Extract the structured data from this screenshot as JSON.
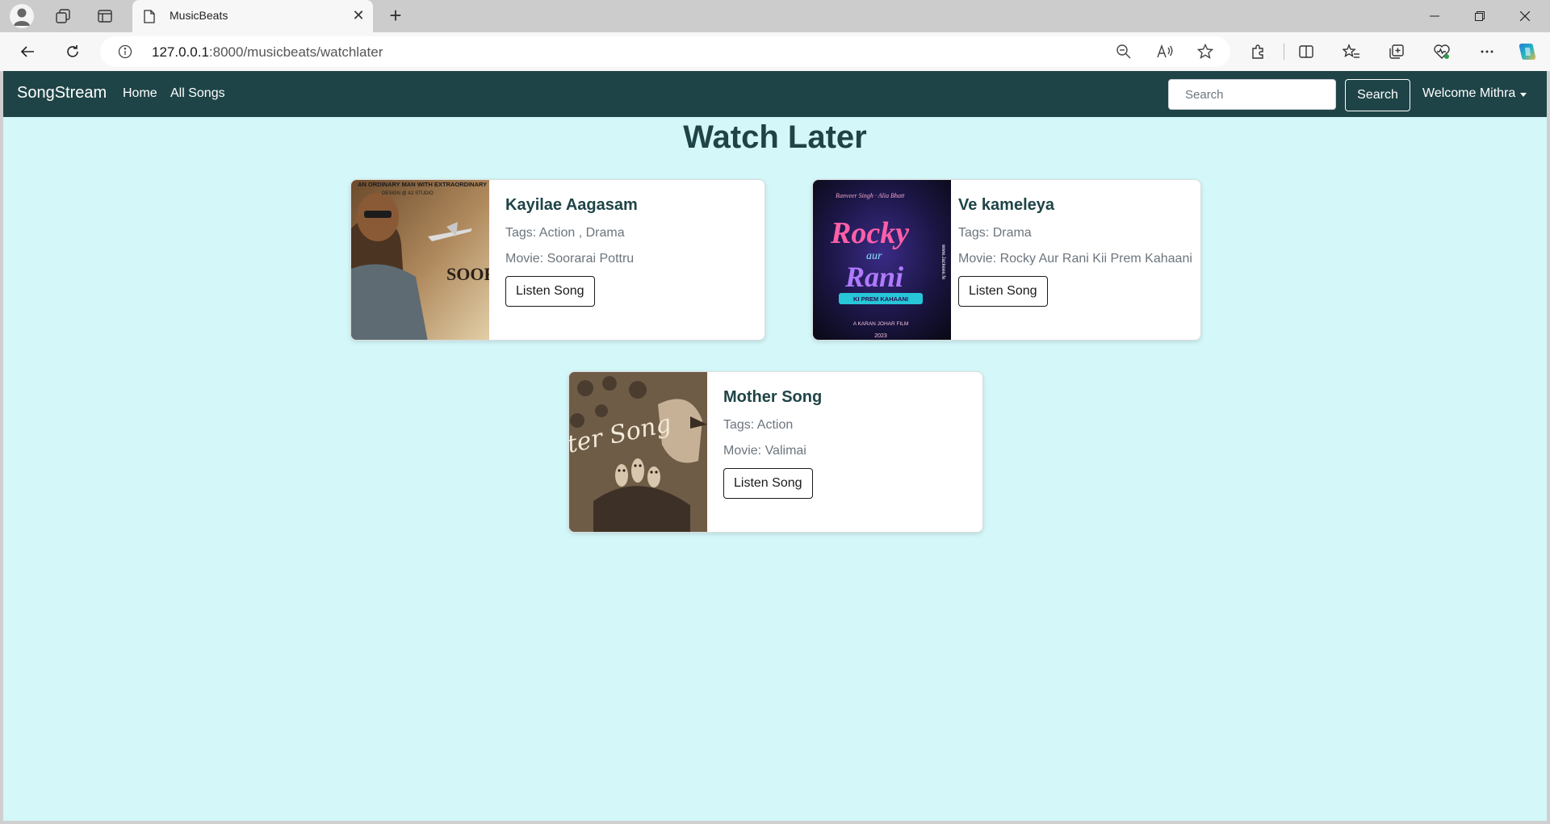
{
  "browser": {
    "tab_title": "MusicBeats",
    "url_host": "127.0.0.1",
    "url_path": ":8000/musicbeats/watchlater"
  },
  "navbar": {
    "brand": "SongStream",
    "links": [
      "Home",
      "All Songs"
    ],
    "search_placeholder": "Search",
    "search_button": "Search",
    "user_menu": "Welcome Mithra"
  },
  "page": {
    "title": "Watch Later"
  },
  "songs": [
    {
      "title": "Kayilae Aagasam",
      "tags": "Tags: Action , Drama",
      "movie": "Movie: Soorarai Pottru",
      "button": "Listen Song",
      "poster_text": "AN ORDINARY MAN WITH EXTRAORDINARY",
      "poster_subtext": "DESIGN @ A2 STUDIO",
      "poster_title": "SOORA"
    },
    {
      "title": "Ve kameleya",
      "tags": "Tags: Drama",
      "movie": "Movie: Rocky Aur Rani Kii Prem Kahaani",
      "button": "Listen Song",
      "poster_top": "Ranveer Singh · Alia Bhatt",
      "poster_title_1": "Rocky",
      "poster_title_2": "aur",
      "poster_title_3": "Rani",
      "poster_banner": "KI PREM KAHAANI",
      "poster_credit": "A KARAN JOHAR FILM",
      "poster_year": "2023",
      "poster_site": "www.Jackeee.fe"
    },
    {
      "title": "Mother Song",
      "tags": "Tags: Action",
      "movie": "Movie: Valimai",
      "button": "Listen Song",
      "poster_script": "ter Song"
    }
  ]
}
